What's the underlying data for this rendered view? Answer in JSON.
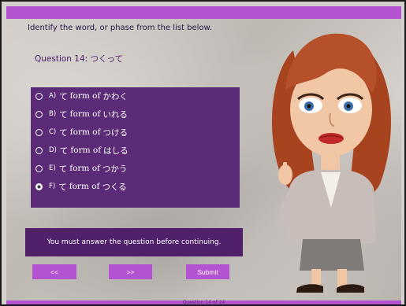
{
  "instructions": "Identify the word, or phase from the list below.",
  "question": "Question 14: つくって",
  "options": [
    {
      "letter": "A)",
      "prefix": "て",
      "mid": "form of",
      "verb": "かわく",
      "selected": false
    },
    {
      "letter": "B)",
      "prefix": "て",
      "mid": "form of",
      "verb": "いれる",
      "selected": false
    },
    {
      "letter": "C)",
      "prefix": "て",
      "mid": "form of",
      "verb": "つける",
      "selected": false
    },
    {
      "letter": "D)",
      "prefix": "て",
      "mid": "form of",
      "verb": "はしる",
      "selected": false
    },
    {
      "letter": "E)",
      "prefix": "て",
      "mid": "form of",
      "verb": "つかう",
      "selected": false
    },
    {
      "letter": "F)",
      "prefix": "て",
      "mid": "form of",
      "verb": "つくる",
      "selected": true
    }
  ],
  "message": "You must answer the question before continuing.",
  "buttons": {
    "prev": "<<",
    "next": ">>",
    "submit": "Submit"
  },
  "footer": "Question 14 of 24",
  "colors": {
    "accent": "#b453d1",
    "panel": "#5b2b77"
  }
}
